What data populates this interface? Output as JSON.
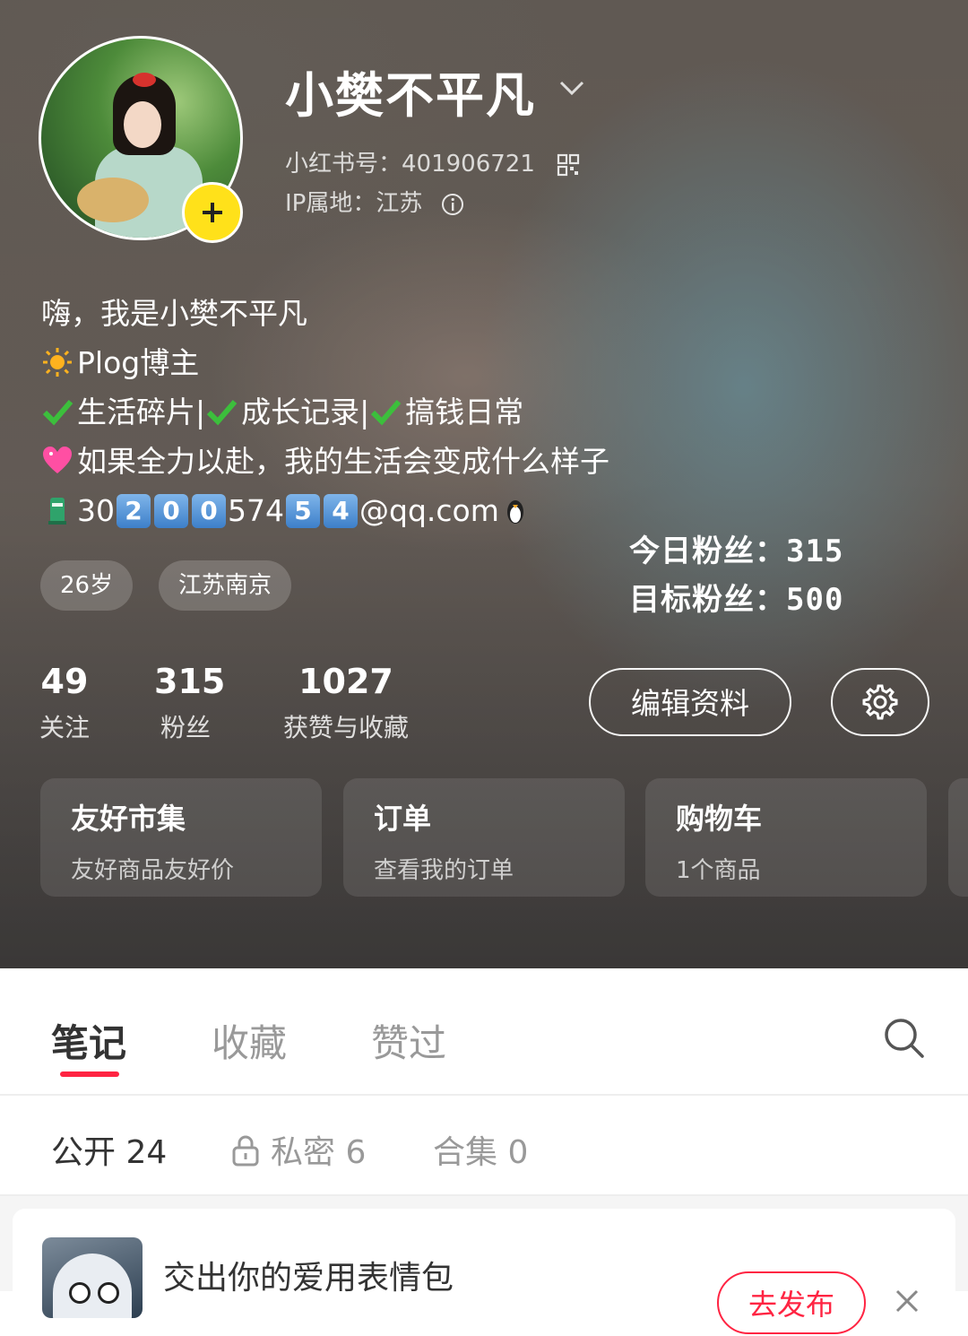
{
  "profile": {
    "username": "小樊不平凡",
    "id_line": "小红书号：401906721",
    "ip_line": "IP属地：江苏",
    "bio": {
      "line1": "嗨，我是小樊不平凡",
      "line2": "Plog博主",
      "line3a": "生活碎片|",
      "line3b": "成长记录|",
      "line3c": "搞钱日常",
      "line4": "如果全力以赴，我的生活会变成什么样子",
      "email_parts": [
        "30",
        "2",
        "0",
        "0",
        "574",
        "5",
        "4",
        "@qq.com"
      ]
    },
    "fans_note": {
      "today": "今日粉丝：315",
      "target": "目标粉丝：500"
    },
    "tags": [
      "26岁",
      "江苏南京"
    ]
  },
  "stats": [
    {
      "num": "49",
      "label": "关注"
    },
    {
      "num": "315",
      "label": "粉丝"
    },
    {
      "num": "1027",
      "label": "获赞与收藏"
    }
  ],
  "actions": {
    "edit_label": "编辑资料"
  },
  "cards": [
    {
      "title": "友好市集",
      "subtitle": "友好商品友好价"
    },
    {
      "title": "订单",
      "subtitle": "查看我的订单"
    },
    {
      "title": "购物车",
      "subtitle": "1个商品"
    }
  ],
  "tabs": [
    "笔记",
    "收藏",
    "赞过"
  ],
  "subtabs": [
    "公开 24",
    "私密 6",
    "合集 0"
  ],
  "draft": {
    "title": "交出你的爱用表情包",
    "publish_label": "去发布"
  },
  "colors": {
    "accent": "#ff2442",
    "plus_badge": "#ffe11a"
  },
  "icons": [
    "chevron-down-icon",
    "qr-code-icon",
    "info-icon",
    "sun-icon",
    "check-icon",
    "sparkle-heart-icon",
    "mailbox-icon",
    "penguin-icon",
    "gear-icon",
    "search-icon",
    "lock-icon",
    "close-icon",
    "plus-icon"
  ]
}
